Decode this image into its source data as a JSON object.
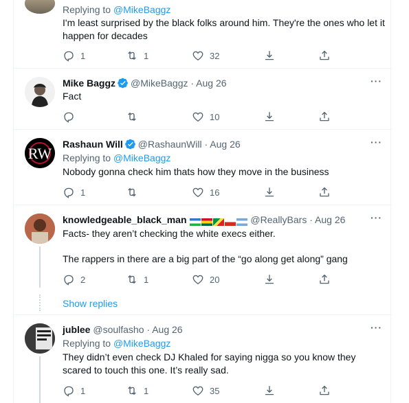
{
  "tweets": [
    {
      "reply_prefix": "Replying to",
      "reply_handle": "@MikeBaggz",
      "text": "I'm least surprised by the black folks around him. They're the ones who let it happen for decades",
      "replies": "1",
      "retweets": "1",
      "likes": "32"
    },
    {
      "name": "Mike Baggz",
      "handle": "@MikeBaggz",
      "sep": "·",
      "date": "Aug 26",
      "text": "Fact",
      "replies": "",
      "retweets": "",
      "likes": "10"
    },
    {
      "name": "Rashaun Will",
      "handle": "@RashaunWill",
      "sep": "·",
      "date": "Aug 26",
      "reply_prefix": "Replying to",
      "reply_handle": "@MikeBaggz",
      "text": "Nobody gonna check him thats how they move in the business",
      "replies": "1",
      "retweets": "",
      "likes": "16"
    },
    {
      "name": "knowledgeable_black_man",
      "handle": "@ReallyBars",
      "sep": "·",
      "date": "Aug 26",
      "text": "Facts- they aren’t checking the white execs either.",
      "text2": "The rappers in there are a big part of the “go along get along” gang",
      "replies": "2",
      "retweets": "1",
      "likes": "20"
    },
    {
      "name": "jublee",
      "handle": "@soulfasho",
      "sep": "·",
      "date": "Aug 26",
      "reply_prefix": "Replying to",
      "reply_handle": "@MikeBaggz",
      "text": "They didn’t even check DJ Khaled for saying nigga so you know they scared to touch this one. It’s really sad.",
      "replies": "1",
      "retweets": "1",
      "likes": "35"
    }
  ],
  "show_replies": "Show replies",
  "more_label": "···",
  "avatar_letters": {
    "rashaun": "RW"
  },
  "colors": {
    "accent": "#1d9bf0",
    "muted": "#536471",
    "text": "#0f1419",
    "border": "#eff3f4"
  },
  "icons": [
    "reply-icon",
    "retweet-icon",
    "like-icon",
    "share-icon",
    "upload-icon",
    "verified-icon",
    "more-icon"
  ]
}
